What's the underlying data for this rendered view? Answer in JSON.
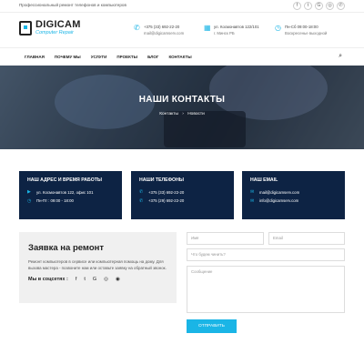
{
  "topbar": {
    "tagline": "Профессиональный ремонт телефонов и компьютеров",
    "social": [
      "f",
      "t",
      "G",
      "◎",
      "✆"
    ]
  },
  "logo": {
    "brand": "DIGICAM",
    "sub": "Computer Repair"
  },
  "contacts_header": [
    {
      "icon": "phone-icon",
      "glyph": "✆",
      "line1": "+375 (33) 692-22-20",
      "line2": "mail@digicamserv.com"
    },
    {
      "icon": "map-icon",
      "glyph": "▦",
      "line1": "ул. Космонавтов 122/101",
      "line2": "г. Минск РБ"
    },
    {
      "icon": "clock-icon",
      "glyph": "◷",
      "line1": "Пн-Сб 09:00-18:00",
      "line2": "Воскресенье выходной"
    }
  ],
  "nav": {
    "items": [
      "ГЛАВНАЯ",
      "ПОЧЕМУ МЫ",
      "УСЛУГИ",
      "ПРОЕКТЫ",
      "БЛОГ",
      "КОНТАКТЫ"
    ],
    "search_icon": "⌕"
  },
  "hero": {
    "title": "НАШИ КОНТАКТЫ",
    "crumb_home": "Контакты",
    "crumb_sep": "›",
    "crumb_current": "Новости"
  },
  "cards": [
    {
      "title": "НАШ АДРЕС И ВРЕМЯ РАБОТЫ",
      "rows": [
        {
          "glyph": "▶",
          "text": "ул. Космонавтов 122, офис 101"
        },
        {
          "glyph": "◷",
          "text": "Пн-Пт : 09:00 - 18:00"
        }
      ]
    },
    {
      "title": "НАШИ ТЕЛЕФОНЫ",
      "rows": [
        {
          "glyph": "✆",
          "text": "+375 (33) 692-22-20"
        },
        {
          "glyph": "✆",
          "text": "+375 (29) 692-22-20"
        }
      ]
    },
    {
      "title": "НАШ EMAIL",
      "rows": [
        {
          "glyph": "✉",
          "text": "mail@digicamserv.com"
        },
        {
          "glyph": "✉",
          "text": "info@digicamserv.com"
        }
      ]
    }
  ],
  "repair": {
    "title": "Заявка на ремонт",
    "text": "Ремонт компьютеров в сервисе или компьютерная помощь на дому. Для вызова мастера - позвоните нам или оставьте заявку на обратный звонок.",
    "social_label": "Мы в соцсетях :",
    "social": [
      "f",
      "t",
      "G",
      "◎",
      "◉"
    ]
  },
  "form": {
    "name_placeholder": "Имя",
    "email_placeholder": "Email",
    "subject_placeholder": "Что будем чинить?",
    "message_placeholder": "Сообщение",
    "submit": "ОТПРАВИТЬ"
  },
  "colors": {
    "accent": "#1ab5e6",
    "dark": "#0d2344"
  }
}
